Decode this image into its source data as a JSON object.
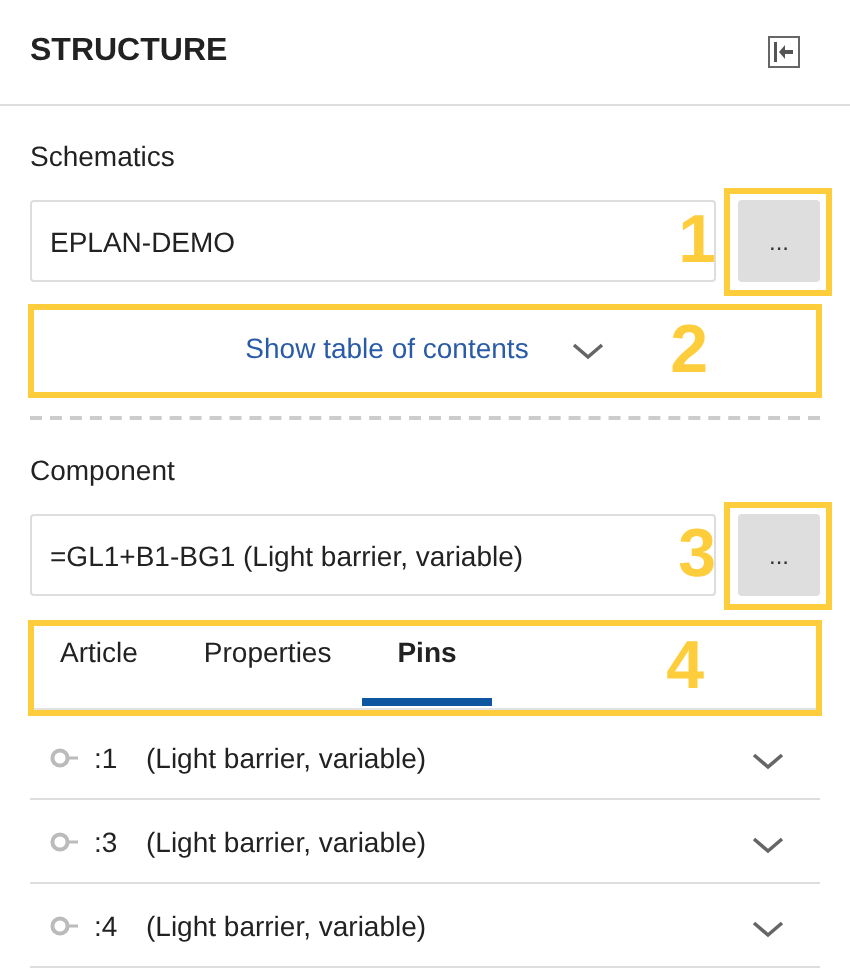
{
  "panel": {
    "title": "STRUCTURE"
  },
  "schematics": {
    "label": "Schematics",
    "value": "EPLAN-DEMO",
    "button": "...",
    "annotation": "1"
  },
  "toc": {
    "label": "Show table of contents",
    "expanded": false,
    "annotation": "2"
  },
  "component": {
    "label": "Component",
    "value": "=GL1+B1-BG1 (Light barrier, variable)",
    "button": "...",
    "annotation": "3"
  },
  "tabs": {
    "annotation": "4",
    "items": [
      {
        "label": "Article",
        "selected": false
      },
      {
        "label": "Properties",
        "selected": false
      },
      {
        "label": "Pins",
        "selected": true
      }
    ]
  },
  "pins": [
    {
      "id": ":1",
      "name": "(Light barrier, variable)",
      "expanded": false
    },
    {
      "id": ":3",
      "name": "(Light barrier, variable)",
      "expanded": false
    },
    {
      "id": ":4",
      "name": "(Light barrier, variable)",
      "expanded": false
    }
  ]
}
